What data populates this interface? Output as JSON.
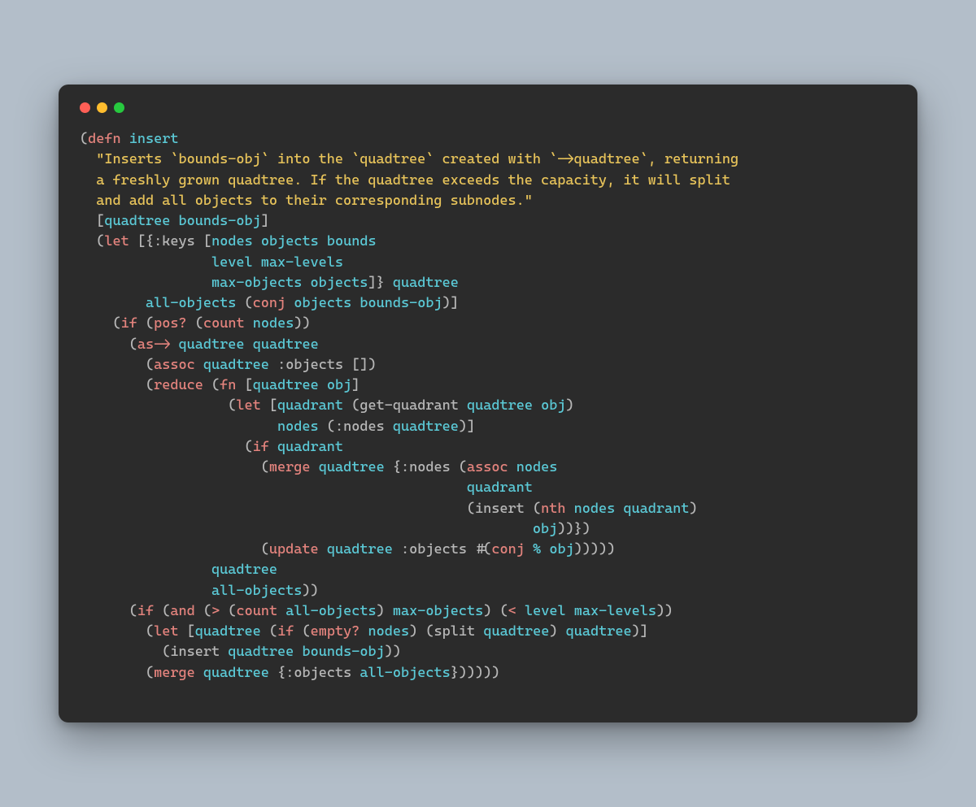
{
  "colors": {
    "page_bg": "#b3bec9",
    "window_bg": "#2b2b2b",
    "traffic_red": "#ff5f56",
    "traffic_yellow": "#ffbd2e",
    "traffic_green": "#27c93f",
    "punct": "#b7b7b7",
    "keyword": "#e3837d",
    "symbol": "#5bc9d6",
    "string": "#e7c35a"
  },
  "code": {
    "lines": [
      [
        [
          "p",
          "("
        ],
        [
          "kw",
          "defn"
        ],
        [
          "p",
          " "
        ],
        [
          "fn",
          "insert"
        ]
      ],
      [
        [
          "p",
          "  "
        ],
        [
          "str",
          "\"Inserts `bounds-obj` into the `quadtree` created with `->quadtree`, returning"
        ]
      ],
      [
        [
          "str",
          "  a freshly grown quadtree. If the quadtree exceeds the capacity, it will split"
        ]
      ],
      [
        [
          "str",
          "  and add all objects to their corresponding subnodes.\""
        ]
      ],
      [
        [
          "p",
          "  ["
        ],
        [
          "sy",
          "quadtree"
        ],
        [
          "p",
          " "
        ],
        [
          "sy",
          "bounds-obj"
        ],
        [
          "p",
          "]"
        ]
      ],
      [
        [
          "p",
          "  ("
        ],
        [
          "kw",
          "let"
        ],
        [
          "p",
          " [{"
        ],
        [
          "id",
          ":keys"
        ],
        [
          "p",
          " ["
        ],
        [
          "sy",
          "nodes"
        ],
        [
          "p",
          " "
        ],
        [
          "sy",
          "objects"
        ],
        [
          "p",
          " "
        ],
        [
          "sy",
          "bounds"
        ]
      ],
      [
        [
          "p",
          "                "
        ],
        [
          "sy",
          "level"
        ],
        [
          "p",
          " "
        ],
        [
          "sy",
          "max-levels"
        ]
      ],
      [
        [
          "p",
          "                "
        ],
        [
          "sy",
          "max-objects"
        ],
        [
          "p",
          " "
        ],
        [
          "sy",
          "objects"
        ],
        [
          "p",
          "]} "
        ],
        [
          "sy",
          "quadtree"
        ]
      ],
      [
        [
          "p",
          "        "
        ],
        [
          "sy",
          "all-objects"
        ],
        [
          "p",
          " ("
        ],
        [
          "kw",
          "conj"
        ],
        [
          "p",
          " "
        ],
        [
          "sy",
          "objects"
        ],
        [
          "p",
          " "
        ],
        [
          "sy",
          "bounds-obj"
        ],
        [
          "p",
          ")]"
        ]
      ],
      [
        [
          "p",
          "    ("
        ],
        [
          "kw",
          "if"
        ],
        [
          "p",
          " ("
        ],
        [
          "kw",
          "pos?"
        ],
        [
          "p",
          " ("
        ],
        [
          "kw",
          "count"
        ],
        [
          "p",
          " "
        ],
        [
          "sy",
          "nodes"
        ],
        [
          "p",
          "))"
        ]
      ],
      [
        [
          "p",
          "      ("
        ],
        [
          "kw",
          "as->"
        ],
        [
          "p",
          " "
        ],
        [
          "sy",
          "quadtree"
        ],
        [
          "p",
          " "
        ],
        [
          "sy",
          "quadtree"
        ]
      ],
      [
        [
          "p",
          "        ("
        ],
        [
          "kw",
          "assoc"
        ],
        [
          "p",
          " "
        ],
        [
          "sy",
          "quadtree"
        ],
        [
          "p",
          " "
        ],
        [
          "id",
          ":objects"
        ],
        [
          "p",
          " [])"
        ]
      ],
      [
        [
          "p",
          "        ("
        ],
        [
          "kw",
          "reduce"
        ],
        [
          "p",
          " ("
        ],
        [
          "kw",
          "fn"
        ],
        [
          "p",
          " ["
        ],
        [
          "sy",
          "quadtree"
        ],
        [
          "p",
          " "
        ],
        [
          "sy",
          "obj"
        ],
        [
          "p",
          "]"
        ]
      ],
      [
        [
          "p",
          "                  ("
        ],
        [
          "kw",
          "let"
        ],
        [
          "p",
          " ["
        ],
        [
          "sy",
          "quadrant"
        ],
        [
          "p",
          " ("
        ],
        [
          "id",
          "get-quadrant"
        ],
        [
          "p",
          " "
        ],
        [
          "sy",
          "quadtree"
        ],
        [
          "p",
          " "
        ],
        [
          "sy",
          "obj"
        ],
        [
          "p",
          ")"
        ]
      ],
      [
        [
          "p",
          "                        "
        ],
        [
          "sy",
          "nodes"
        ],
        [
          "p",
          " ("
        ],
        [
          "id",
          ":nodes"
        ],
        [
          "p",
          " "
        ],
        [
          "sy",
          "quadtree"
        ],
        [
          "p",
          ")]"
        ]
      ],
      [
        [
          "p",
          "                    ("
        ],
        [
          "kw",
          "if"
        ],
        [
          "p",
          " "
        ],
        [
          "sy",
          "quadrant"
        ]
      ],
      [
        [
          "p",
          "                      ("
        ],
        [
          "kw",
          "merge"
        ],
        [
          "p",
          " "
        ],
        [
          "sy",
          "quadtree"
        ],
        [
          "p",
          " {"
        ],
        [
          "id",
          ":nodes"
        ],
        [
          "p",
          " ("
        ],
        [
          "kw",
          "assoc"
        ],
        [
          "p",
          " "
        ],
        [
          "sy",
          "nodes"
        ]
      ],
      [
        [
          "p",
          "                                               "
        ],
        [
          "sy",
          "quadrant"
        ]
      ],
      [
        [
          "p",
          "                                               ("
        ],
        [
          "id",
          "insert"
        ],
        [
          "p",
          " ("
        ],
        [
          "kw",
          "nth"
        ],
        [
          "p",
          " "
        ],
        [
          "sy",
          "nodes"
        ],
        [
          "p",
          " "
        ],
        [
          "sy",
          "quadrant"
        ],
        [
          "p",
          ")"
        ]
      ],
      [
        [
          "p",
          "                                                       "
        ],
        [
          "sy",
          "obj"
        ],
        [
          "p",
          "))})"
        ]
      ],
      [
        [
          "p",
          "                      ("
        ],
        [
          "kw",
          "update"
        ],
        [
          "p",
          " "
        ],
        [
          "sy",
          "quadtree"
        ],
        [
          "p",
          " "
        ],
        [
          "id",
          ":objects"
        ],
        [
          "p",
          " #("
        ],
        [
          "kw",
          "conj"
        ],
        [
          "p",
          " "
        ],
        [
          "sy",
          "%"
        ],
        [
          "p",
          " "
        ],
        [
          "sy",
          "obj"
        ],
        [
          "p",
          ")))))"
        ]
      ],
      [
        [
          "p",
          "                "
        ],
        [
          "sy",
          "quadtree"
        ]
      ],
      [
        [
          "p",
          "                "
        ],
        [
          "sy",
          "all-objects"
        ],
        [
          "p",
          "))"
        ]
      ],
      [
        [
          "p",
          "      ("
        ],
        [
          "kw",
          "if"
        ],
        [
          "p",
          " ("
        ],
        [
          "kw",
          "and"
        ],
        [
          "p",
          " ("
        ],
        [
          "kw",
          ">"
        ],
        [
          "p",
          " ("
        ],
        [
          "kw",
          "count"
        ],
        [
          "p",
          " "
        ],
        [
          "sy",
          "all-objects"
        ],
        [
          "p",
          ") "
        ],
        [
          "sy",
          "max-objects"
        ],
        [
          "p",
          ") ("
        ],
        [
          "kw",
          "<"
        ],
        [
          "p",
          " "
        ],
        [
          "sy",
          "level"
        ],
        [
          "p",
          " "
        ],
        [
          "sy",
          "max-levels"
        ],
        [
          "p",
          "))"
        ]
      ],
      [
        [
          "p",
          "        ("
        ],
        [
          "kw",
          "let"
        ],
        [
          "p",
          " ["
        ],
        [
          "sy",
          "quadtree"
        ],
        [
          "p",
          " ("
        ],
        [
          "kw",
          "if"
        ],
        [
          "p",
          " ("
        ],
        [
          "kw",
          "empty?"
        ],
        [
          "p",
          " "
        ],
        [
          "sy",
          "nodes"
        ],
        [
          "p",
          ") ("
        ],
        [
          "id",
          "split"
        ],
        [
          "p",
          " "
        ],
        [
          "sy",
          "quadtree"
        ],
        [
          "p",
          ") "
        ],
        [
          "sy",
          "quadtree"
        ],
        [
          "p",
          ")]"
        ]
      ],
      [
        [
          "p",
          "          ("
        ],
        [
          "id",
          "insert"
        ],
        [
          "p",
          " "
        ],
        [
          "sy",
          "quadtree"
        ],
        [
          "p",
          " "
        ],
        [
          "sy",
          "bounds-obj"
        ],
        [
          "p",
          "))"
        ]
      ],
      [
        [
          "p",
          "        ("
        ],
        [
          "kw",
          "merge"
        ],
        [
          "p",
          " "
        ],
        [
          "sy",
          "quadtree"
        ],
        [
          "p",
          " {"
        ],
        [
          "id",
          ":objects"
        ],
        [
          "p",
          " "
        ],
        [
          "sy",
          "all-objects"
        ],
        [
          "p",
          "})))))"
        ]
      ]
    ]
  }
}
